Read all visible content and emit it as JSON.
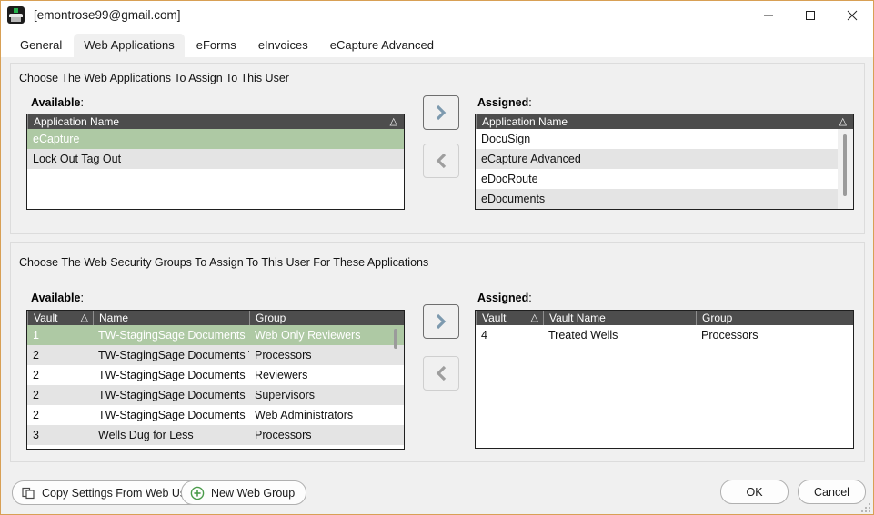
{
  "window": {
    "title": "[emontrose99@gmail.com]",
    "icon": "app-icon",
    "accent_border": "#d8a055",
    "controls": {
      "minimize": "minimize-icon",
      "maximize": "maximize-icon",
      "close": "close-icon"
    }
  },
  "tabs": [
    {
      "label": "General",
      "active": false
    },
    {
      "label": "Web Applications",
      "active": true
    },
    {
      "label": "eForms",
      "active": false
    },
    {
      "label": "eInvoices",
      "active": false
    },
    {
      "label": "eCapture Advanced",
      "active": false
    }
  ],
  "applications_section": {
    "caption": "Choose The Web Applications To Assign To This User",
    "available": {
      "label": "Available",
      "columns": [
        {
          "title": "Application Name",
          "sort": "△"
        }
      ],
      "rows": [
        {
          "cells": [
            "eCapture"
          ],
          "state": "selected"
        },
        {
          "cells": [
            "Lock Out Tag Out"
          ],
          "state": "alt"
        }
      ]
    },
    "assigned": {
      "label": "Assigned",
      "columns": [
        {
          "title": "Application Name",
          "sort": "△"
        }
      ],
      "rows": [
        {
          "cells": [
            "DocuSign"
          ],
          "state": "normal"
        },
        {
          "cells": [
            "eCapture Advanced"
          ],
          "state": "alt"
        },
        {
          "cells": [
            "eDocRoute"
          ],
          "state": "normal"
        },
        {
          "cells": [
            "eDocuments"
          ],
          "state": "alt"
        }
      ],
      "scrollbar": true
    },
    "move_right_button": "chevron-right-icon",
    "move_left_button": "chevron-left-icon"
  },
  "security_groups_section": {
    "caption": "Choose The Web Security Groups To Assign To This User For These Applications",
    "available": {
      "label": "Available",
      "columns": [
        {
          "title": "Vault",
          "sort": "△"
        },
        {
          "title": "Name",
          "sort": ""
        },
        {
          "title": "Group",
          "sort": ""
        }
      ],
      "rows": [
        {
          "cells": [
            "1",
            "TW-StagingSage Documents",
            "Web Only Reviewers"
          ],
          "state": "selected"
        },
        {
          "cells": [
            "2",
            "TW-StagingSage Documents Test",
            "Processors"
          ],
          "state": "alt"
        },
        {
          "cells": [
            "2",
            "TW-StagingSage Documents Test",
            "Reviewers"
          ],
          "state": "normal"
        },
        {
          "cells": [
            "2",
            "TW-StagingSage Documents Test",
            "Supervisors"
          ],
          "state": "alt"
        },
        {
          "cells": [
            "2",
            "TW-StagingSage Documents Test",
            "Web Administrators"
          ],
          "state": "normal"
        },
        {
          "cells": [
            "3",
            "Wells Dug for Less",
            "Processors"
          ],
          "state": "alt"
        }
      ],
      "scrollbar": true
    },
    "assigned": {
      "label": "Assigned",
      "columns": [
        {
          "title": "Vault",
          "sort": "△"
        },
        {
          "title": "Vault Name",
          "sort": ""
        },
        {
          "title": "Group",
          "sort": ""
        }
      ],
      "rows": [
        {
          "cells": [
            "4",
            "Treated Wells",
            "Processors"
          ],
          "state": "normal"
        }
      ],
      "scrollbar": false
    },
    "move_right_button": "chevron-right-icon",
    "move_left_button": "chevron-left-icon"
  },
  "footer": {
    "copy_settings_label": "Copy Settings From Web User",
    "copy_settings_icon": "copy-icon",
    "new_web_group_label": "New Web Group",
    "new_web_group_icon": "plus-circle-icon",
    "ok_label": "OK",
    "cancel_label": "Cancel"
  },
  "colors": {
    "selection_green": "#aec9a4",
    "header_gray": "#4d4d4d",
    "arrow_active": "#7d9aaf",
    "arrow_inactive": "#9e9e9e",
    "plus_green": "#4a9b4a",
    "window_accent": "#d8a055"
  }
}
